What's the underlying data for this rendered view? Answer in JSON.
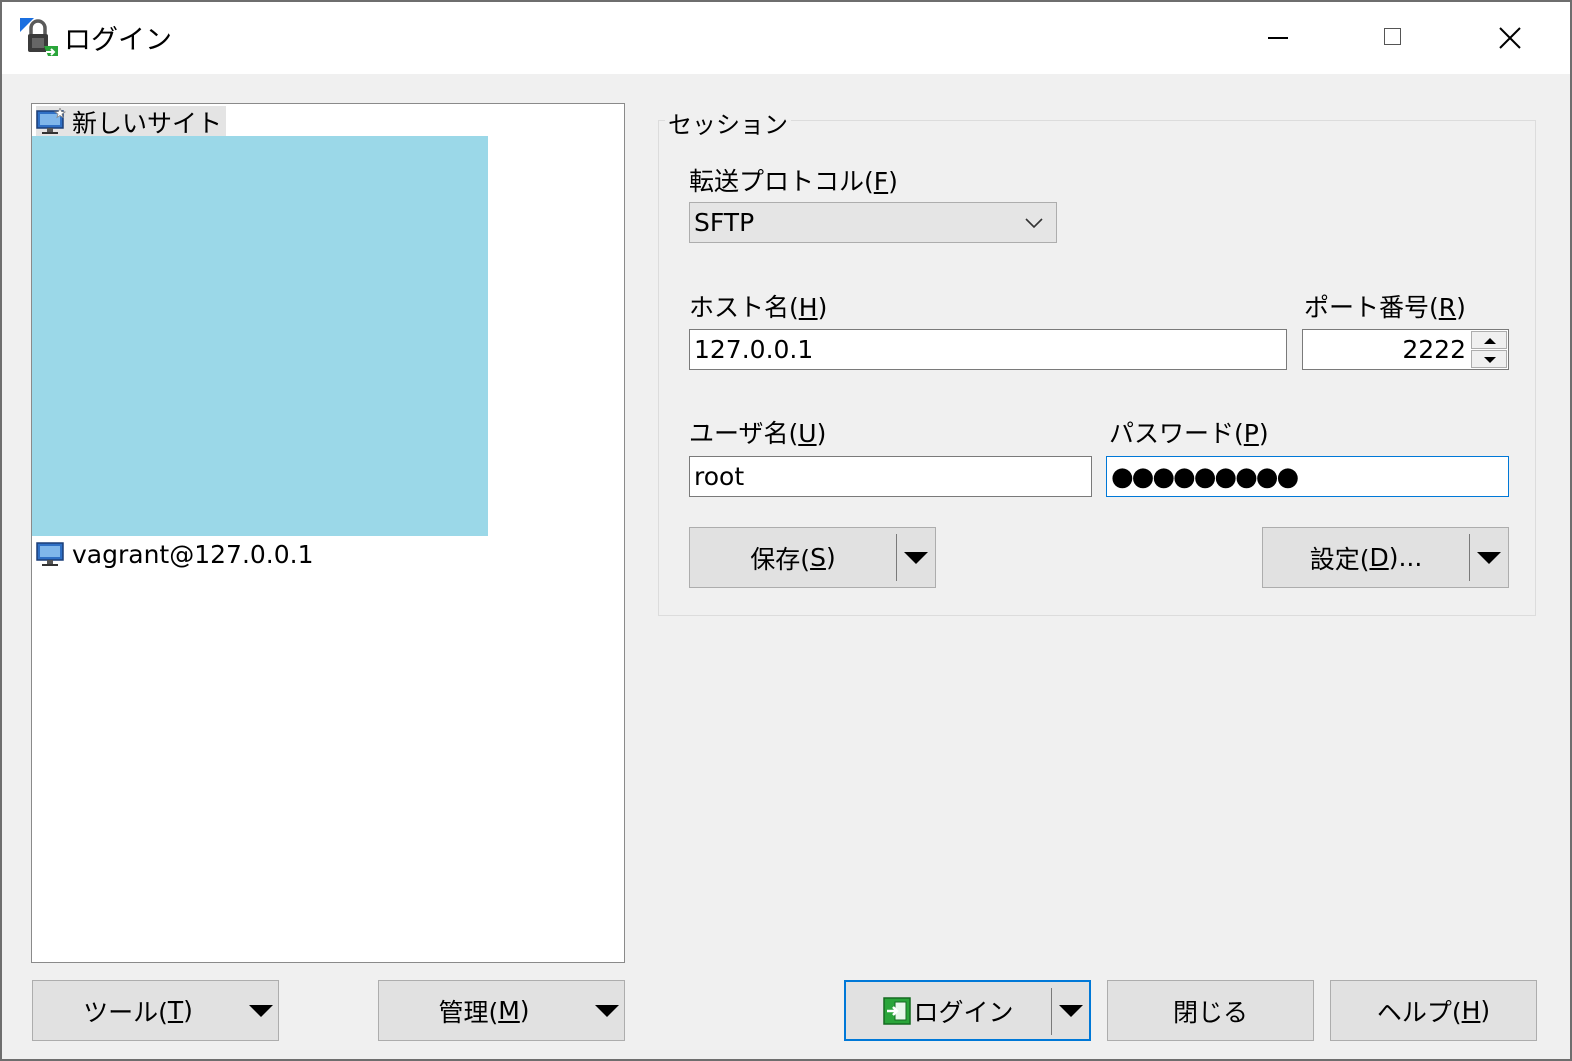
{
  "window": {
    "title": "ログイン"
  },
  "site_tree": {
    "items": [
      {
        "label": "新しいサイト"
      },
      {
        "label": "vagrant@127.0.0.1"
      }
    ]
  },
  "session": {
    "group_label": "セッション",
    "protocol_label": "転送プロトコル(",
    "protocol_key": "F",
    "protocol_value": "SFTP",
    "host_label": "ホスト名(",
    "host_key": "H",
    "host_value": "127.0.0.1",
    "port_label": "ポート番号(",
    "port_key": "R",
    "port_value": "2222",
    "user_label": "ユーザ名(",
    "user_key": "U",
    "user_value": "root",
    "password_label": "パスワード(",
    "password_key": "P",
    "password_mask": "●●●●●●●●●",
    "save_label": "保存(",
    "save_key": "S",
    "advanced_label": "設定(",
    "advanced_key": "D",
    "advanced_suffix": ")..."
  },
  "bottom": {
    "tools_label": "ツール(",
    "tools_key": "T",
    "manage_label": "管理(",
    "manage_key": "M",
    "login_label": "ログイン",
    "close_label": "閉じる",
    "help_label": "ヘルプ(",
    "help_key": "H"
  },
  "colors": {
    "accent": "#0078d7",
    "redaction": "#9bd8e8"
  }
}
